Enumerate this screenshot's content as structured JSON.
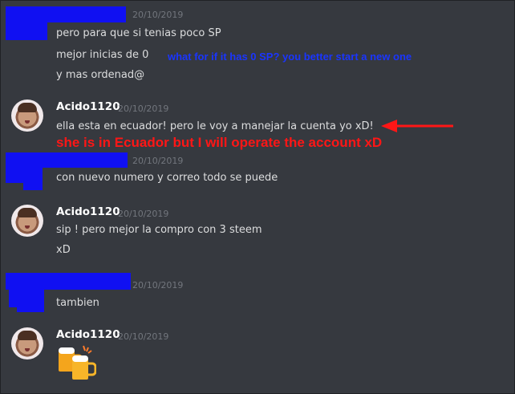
{
  "messages": [
    {
      "type": "redacted_header",
      "timestamp": "20/10/2019",
      "lines": [
        "pero para que si tenias poco SP",
        "mejor inicias de 0",
        "y mas ordenad@"
      ]
    },
    {
      "type": "user",
      "username": "Acido1120",
      "timestamp": "20/10/2019",
      "lines": [
        "ella esta en ecuador! pero le voy a manejar la cuenta yo xD!"
      ]
    },
    {
      "type": "redacted_header",
      "timestamp": "20/10/2019",
      "lines": [
        "con nuevo numero y correo todo se puede"
      ]
    },
    {
      "type": "user",
      "username": "Acido1120",
      "timestamp": "20/10/2019",
      "lines": [
        "sip ! pero mejor la compro con 3 steem",
        "xD"
      ]
    },
    {
      "type": "redacted_header",
      "timestamp": "20/10/2019",
      "lines": [
        "tambien"
      ]
    },
    {
      "type": "user",
      "username": "Acido1120",
      "timestamp": "20/10/2019",
      "emoji": "beers-icon"
    }
  ],
  "annotations": {
    "blue": "what for if it has 0 SP? you better start a new one",
    "red": "she is in Ecuador but I will operate the account xD"
  },
  "colors": {
    "background": "#36393f",
    "redaction": "#1010f2",
    "annotation_blue": "#1a35ff",
    "annotation_red": "#ff1616",
    "timestamp": "#72767d"
  }
}
